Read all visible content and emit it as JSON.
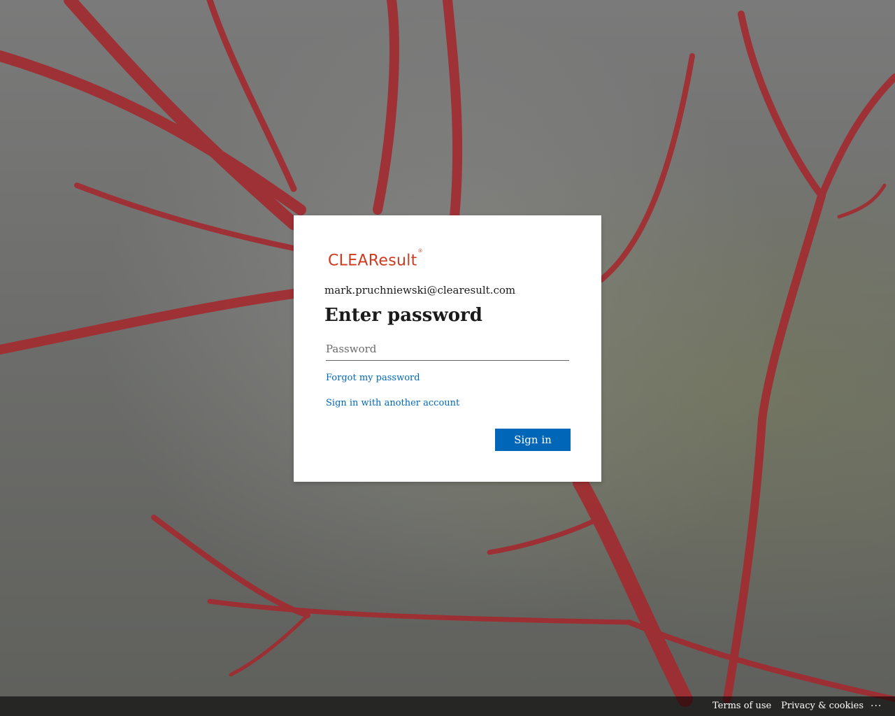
{
  "brand": {
    "logo_text": "CLEAResult",
    "logo_mark": "®",
    "logo_color": "#cf3a1e"
  },
  "signin": {
    "account": "mark.pruchniewski@clearesult.com",
    "title": "Enter password",
    "password_placeholder": "Password",
    "password_value": "",
    "forgot_link": "Forgot my password",
    "another_account_link": "Sign in with another account",
    "submit_label": "Sign in",
    "accent_color": "#0067b8"
  },
  "footer": {
    "terms": "Terms of use",
    "privacy": "Privacy & cookies",
    "more": "..."
  },
  "background": {
    "description_icon": "red-branches-image"
  }
}
